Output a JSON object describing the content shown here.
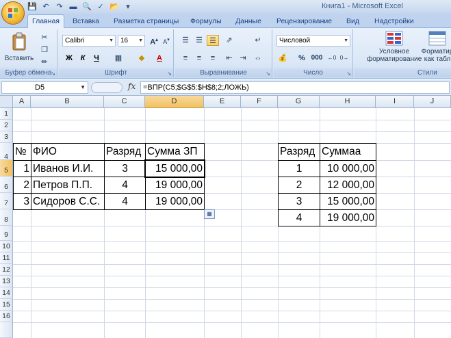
{
  "window_title": "Книга1 - Microsoft Excel",
  "tabs": [
    "Главная",
    "Вставка",
    "Разметка страницы",
    "Формулы",
    "Данные",
    "Рецензирование",
    "Вид",
    "Надстройки"
  ],
  "ribbon": {
    "clipboard": {
      "paste_label": "Вставить",
      "group_label": "Буфер обмена"
    },
    "font": {
      "font_name": "Calibri",
      "font_size": "16",
      "group_label": "Шрифт",
      "bold": "Ж",
      "italic": "К",
      "underline": "Ч"
    },
    "alignment": {
      "group_label": "Выравнивание"
    },
    "number": {
      "format": "Числовой",
      "group_label": "Число",
      "percent": "%",
      "thousands": "000"
    },
    "styles": {
      "conditional_label_1": "Условное",
      "conditional_label_2": "форматирование",
      "format_table_1": "Форматир",
      "format_table_2": "как табл",
      "group_label": "Стили"
    }
  },
  "formula_bar": {
    "name_box": "D5",
    "fx": "fx",
    "formula": "=ВПР(C5;$G$5:$H$8;2;ЛОЖЬ)"
  },
  "columns": [
    "A",
    "B",
    "C",
    "D",
    "E",
    "F",
    "G",
    "H",
    "I",
    "J"
  ],
  "rows": [
    "1",
    "2",
    "3",
    "4",
    "5",
    "6",
    "7",
    "8",
    "9",
    "10",
    "11",
    "12",
    "13",
    "14",
    "15",
    "16"
  ],
  "table1": {
    "headers": [
      "№",
      "ФИО",
      "Разряд",
      "Сумма ЗП"
    ],
    "rows": [
      [
        "1",
        "Иванов И.И.",
        "3",
        "15 000,00"
      ],
      [
        "2",
        "Петров П.П.",
        "4",
        "19 000,00"
      ],
      [
        "3",
        "Сидоров С.С.",
        "4",
        "19 000,00"
      ]
    ]
  },
  "table2": {
    "headers": [
      "Разряд",
      "Суммаа"
    ],
    "rows": [
      [
        "1",
        "10 000,00"
      ],
      [
        "2",
        "12 000,00"
      ],
      [
        "3",
        "15 000,00"
      ],
      [
        "4",
        "19 000,00"
      ]
    ]
  },
  "selected_cell": "D5"
}
